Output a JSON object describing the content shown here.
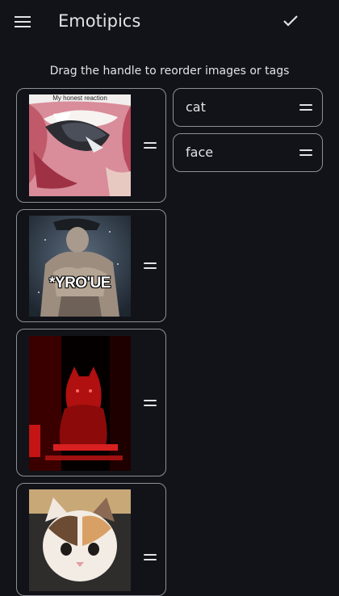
{
  "app_bar": {
    "title": "Emotipics",
    "menu_icon": "menu-icon",
    "confirm_icon": "check-icon"
  },
  "hint": "Drag the handle to reorder images or tags",
  "images": [
    {
      "caption": "My honest reaction",
      "overlay_text": ""
    },
    {
      "caption": "",
      "overlay_text": "*YRO'UE"
    },
    {
      "caption": "",
      "overlay_text": ""
    },
    {
      "caption": "",
      "overlay_text": ""
    }
  ],
  "tags": [
    {
      "label": "cat"
    },
    {
      "label": "face"
    }
  ],
  "colors": {
    "background": "#111318",
    "card_border": "#8e9099",
    "text": "#e3e2e6"
  }
}
